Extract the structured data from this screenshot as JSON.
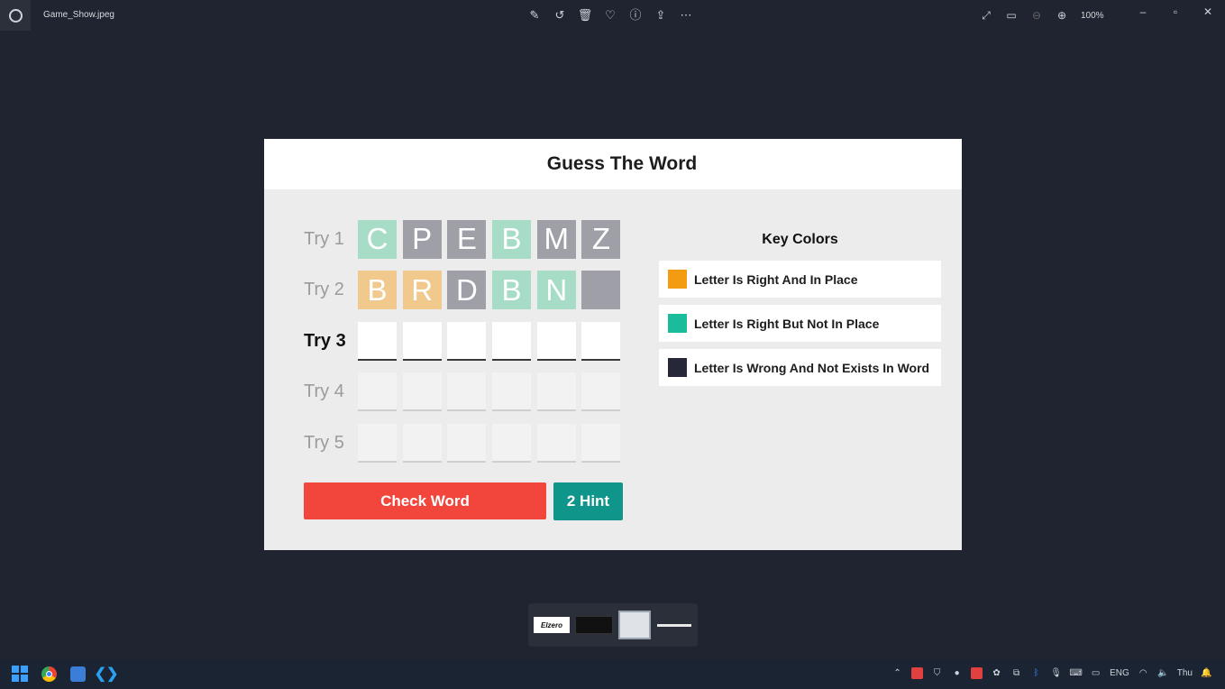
{
  "viewer": {
    "filename": "Game_Show.jpeg",
    "zoom": "100%",
    "toolbar_icons": [
      "edit-icon",
      "rotate-icon",
      "delete-icon",
      "favorite-icon",
      "info-icon",
      "share-icon",
      "more-icon"
    ],
    "view_icons": [
      "fullscreen-icon",
      "fit-icon",
      "zoom-out-icon",
      "zoom-in-icon"
    ],
    "window_controls": {
      "minimize": "–",
      "maximize": "▫",
      "close": "✕"
    }
  },
  "game": {
    "title": "Guess The Word",
    "tries": [
      {
        "label": "Try 1",
        "cells": [
          {
            "letter": "C",
            "color": "t"
          },
          {
            "letter": "P",
            "color": "g"
          },
          {
            "letter": "E",
            "color": "g"
          },
          {
            "letter": "B",
            "color": "t"
          },
          {
            "letter": "M",
            "color": "g"
          },
          {
            "letter": "Z",
            "color": "g"
          }
        ]
      },
      {
        "label": "Try 2",
        "cells": [
          {
            "letter": "B",
            "color": "o"
          },
          {
            "letter": "R",
            "color": "o"
          },
          {
            "letter": "D",
            "color": "g"
          },
          {
            "letter": "B",
            "color": "t"
          },
          {
            "letter": "N",
            "color": "t"
          },
          {
            "letter": "",
            "color": "g"
          }
        ]
      },
      {
        "label": "Try 3",
        "cells": [
          {
            "letter": "",
            "color": "empty"
          },
          {
            "letter": "",
            "color": "empty"
          },
          {
            "letter": "",
            "color": "empty"
          },
          {
            "letter": "",
            "color": "empty"
          },
          {
            "letter": "",
            "color": "empty"
          },
          {
            "letter": "",
            "color": "empty"
          }
        ]
      },
      {
        "label": "Try 4",
        "cells": [
          {
            "letter": "",
            "color": "disabled"
          },
          {
            "letter": "",
            "color": "disabled"
          },
          {
            "letter": "",
            "color": "disabled"
          },
          {
            "letter": "",
            "color": "disabled"
          },
          {
            "letter": "",
            "color": "disabled"
          },
          {
            "letter": "",
            "color": "disabled"
          }
        ]
      },
      {
        "label": "Try 5",
        "cells": [
          {
            "letter": "",
            "color": "disabled"
          },
          {
            "letter": "",
            "color": "disabled"
          },
          {
            "letter": "",
            "color": "disabled"
          },
          {
            "letter": "",
            "color": "disabled"
          },
          {
            "letter": "",
            "color": "disabled"
          },
          {
            "letter": "",
            "color": "disabled"
          }
        ]
      }
    ],
    "check_button": "Check Word",
    "hint_button": "2 Hint",
    "key": {
      "title": "Key Colors",
      "items": [
        {
          "text": "Letter Is Right And In Place",
          "color": "#f39c12"
        },
        {
          "text": "Letter Is Right But Not In Place",
          "color": "#1abc9c"
        },
        {
          "text": "Letter Is Wrong And Not Exists In Word",
          "color": "#27273a"
        }
      ]
    }
  },
  "filmstrip": {
    "thumb1_text": "Elzero"
  },
  "taskbar": {
    "apps": [
      "windows-start-icon",
      "chrome-icon",
      "photos-icon",
      "vscode-icon"
    ],
    "lang": "ENG",
    "day": "Thu"
  }
}
